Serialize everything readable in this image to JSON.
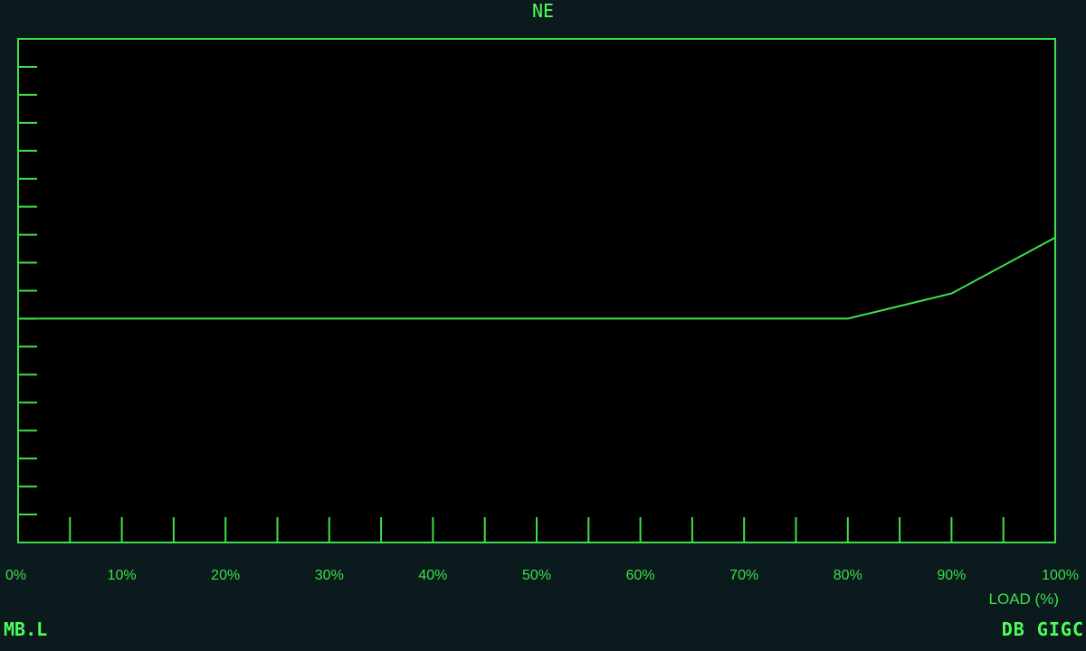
{
  "chart_data": {
    "type": "line",
    "title": "NE",
    "xlabel": "LOAD (%)",
    "ylabel": "",
    "x_ticks": [
      "0%",
      "10%",
      "20%",
      "30%",
      "40%",
      "50%",
      "60%",
      "70%",
      "80%",
      "90%",
      "100%"
    ],
    "xlim": [
      0,
      100
    ],
    "series": [
      {
        "x": [
          0,
          80,
          90,
          100
        ],
        "y": [
          100,
          100,
          109,
          129
        ]
      }
    ],
    "ylim": [
      20,
      200
    ],
    "grid": false
  },
  "footer": {
    "left_text": "MB.L",
    "right_text": "DB GIGC"
  },
  "colors": {
    "background": "#0b1a1d",
    "plot_background": "#000000",
    "line": "#3ee04a"
  }
}
